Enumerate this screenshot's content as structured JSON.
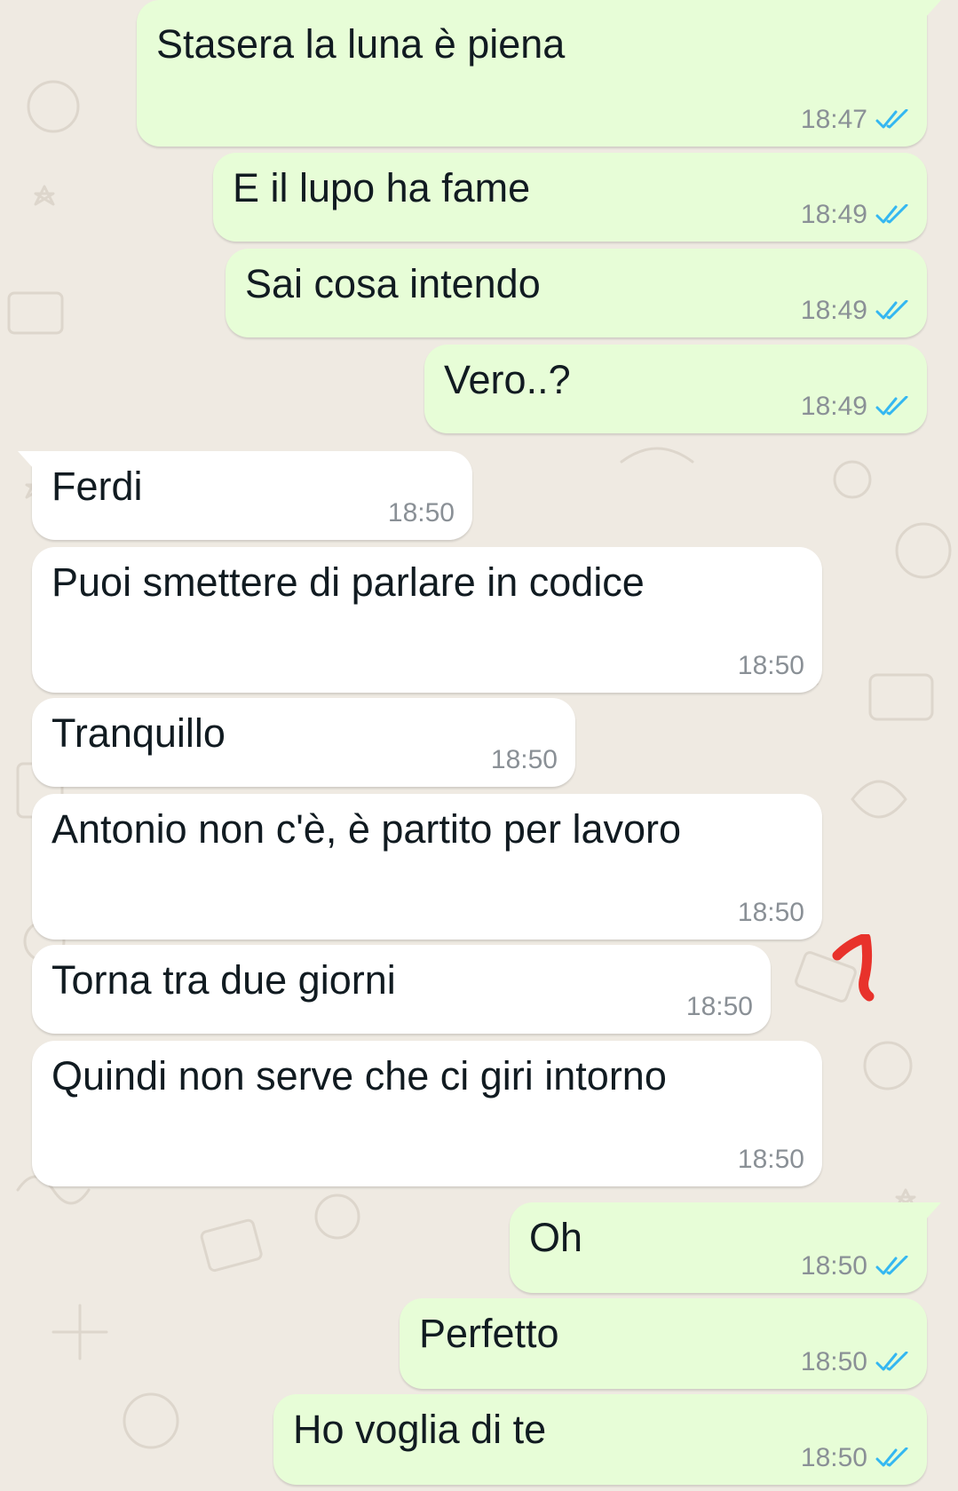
{
  "theme": {
    "outgoing_bubble": "#e7fdd7",
    "incoming_bubble": "#ffffff",
    "background": "#efeae2",
    "read_tick_color": "#34b7f1",
    "annotation_color": "#e8322b"
  },
  "messages": [
    {
      "text": "Stasera la luna è piena",
      "time": "18:47",
      "direction": "outgoing",
      "status": "read"
    },
    {
      "text": "E il lupo ha fame",
      "time": "18:49",
      "direction": "outgoing",
      "status": "read"
    },
    {
      "text": "Sai cosa intendo",
      "time": "18:49",
      "direction": "outgoing",
      "status": "read"
    },
    {
      "text": "Vero..?",
      "time": "18:49",
      "direction": "outgoing",
      "status": "read"
    },
    {
      "text": "Ferdi",
      "time": "18:50",
      "direction": "incoming"
    },
    {
      "text": "Puoi smettere di parlare in codice",
      "time": "18:50",
      "direction": "incoming"
    },
    {
      "text": "Tranquillo",
      "time": "18:50",
      "direction": "incoming"
    },
    {
      "text": "Antonio non c'è, è partito per lavoro",
      "time": "18:50",
      "direction": "incoming"
    },
    {
      "text": "Torna tra due giorni",
      "time": "18:50",
      "direction": "incoming"
    },
    {
      "text": "Quindi non serve che ci giri intorno",
      "time": "18:50",
      "direction": "incoming"
    },
    {
      "text": "Oh",
      "time": "18:50",
      "direction": "outgoing",
      "status": "read"
    },
    {
      "text": "Perfetto",
      "time": "18:50",
      "direction": "outgoing",
      "status": "read"
    },
    {
      "text": "Ho voglia di te",
      "time": "18:50",
      "direction": "outgoing",
      "status": "read"
    }
  ],
  "annotation": {
    "text": "1",
    "color": "#e8322b"
  }
}
